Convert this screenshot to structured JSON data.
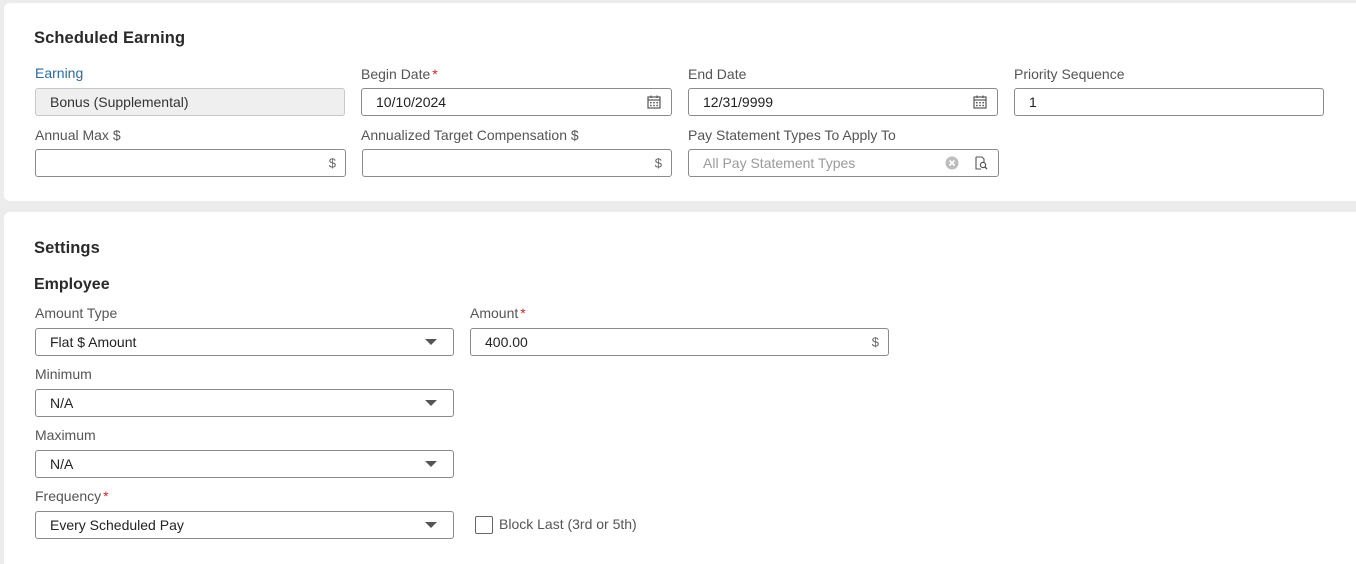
{
  "scheduled_earning": {
    "title": "Scheduled Earning",
    "earning": {
      "label": "Earning",
      "value": "Bonus (Supplemental)"
    },
    "begin_date": {
      "label": "Begin Date",
      "required": "*",
      "value": "10/10/2024",
      "icon": "calendar-icon"
    },
    "end_date": {
      "label": "End Date",
      "value": "12/31/9999",
      "icon": "calendar-icon"
    },
    "priority_sequence": {
      "label": "Priority Sequence",
      "value": "1"
    },
    "annual_max": {
      "label": "Annual Max $",
      "value": "",
      "suffix": "$"
    },
    "annualized_target": {
      "label": "Annualized Target Compensation $",
      "value": "",
      "suffix": "$"
    },
    "pay_statement_types": {
      "label": "Pay Statement Types To Apply To",
      "placeholder": "All Pay Statement Types",
      "icons": [
        "clear-icon",
        "lookup-icon"
      ]
    }
  },
  "settings": {
    "title": "Settings",
    "employee": {
      "title": "Employee",
      "amount_type": {
        "label": "Amount Type",
        "value": "Flat $ Amount"
      },
      "amount": {
        "label": "Amount",
        "required": "*",
        "value": "400.00",
        "suffix": "$"
      },
      "minimum": {
        "label": "Minimum",
        "value": "N/A"
      },
      "maximum": {
        "label": "Maximum",
        "value": "N/A"
      },
      "frequency": {
        "label": "Frequency",
        "required": "*",
        "value": "Every Scheduled Pay"
      },
      "block_last": {
        "label": "Block Last (3rd or 5th)",
        "checked": false
      }
    }
  },
  "colors": {
    "page_bg": "#ececec",
    "card_bg": "#ffffff",
    "earning_label": "#2b6a9d",
    "required": "#c62828"
  }
}
